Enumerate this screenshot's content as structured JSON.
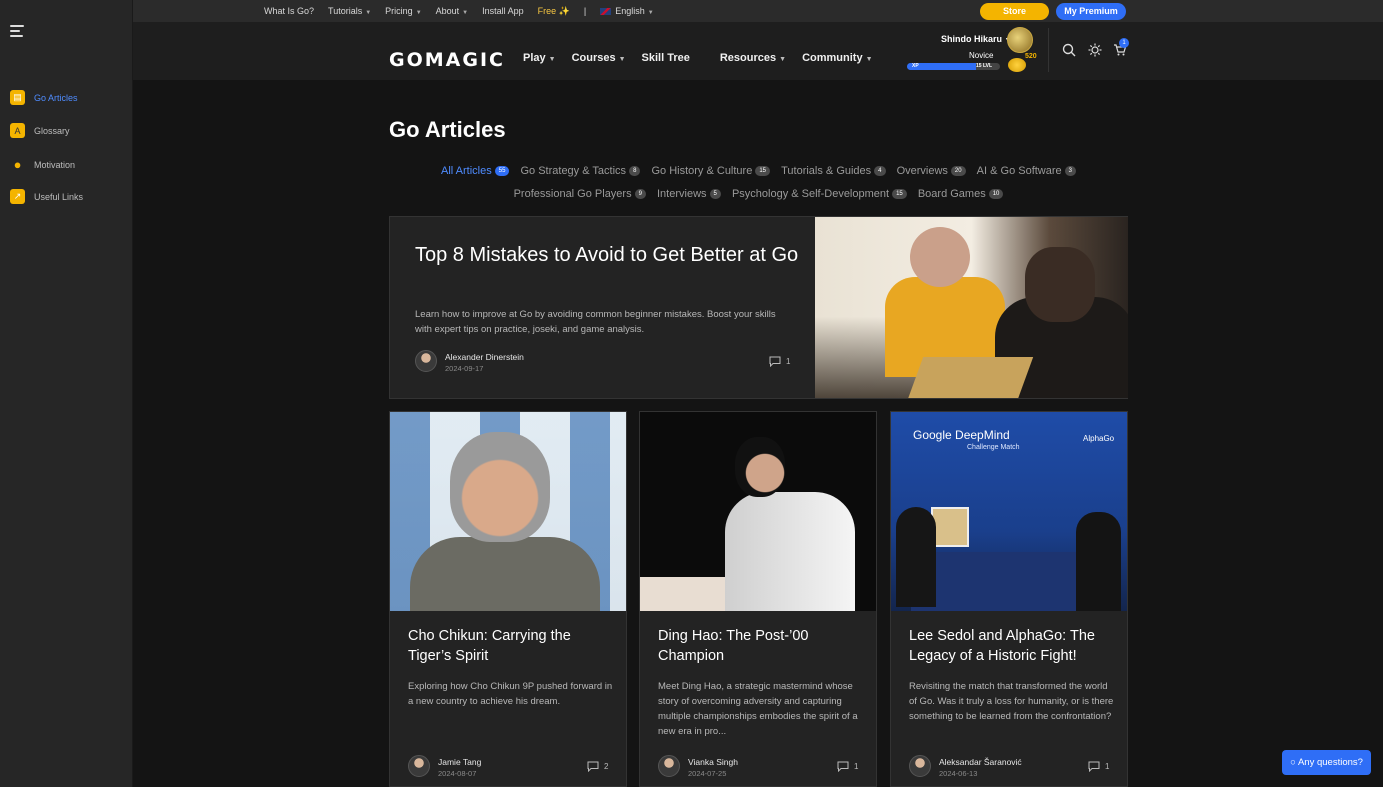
{
  "sidebar": {
    "items": [
      {
        "label": "Go Articles",
        "icon": "book-icon",
        "color": "#f4b400",
        "active": true
      },
      {
        "label": "Glossary",
        "icon": "glossary-icon",
        "color": "#f4b400"
      },
      {
        "label": "Motivation",
        "icon": "lightbulb-icon",
        "color": "#f4b400"
      },
      {
        "label": "Useful Links",
        "icon": "link-icon",
        "color": "#f4b400"
      }
    ]
  },
  "topbar": {
    "links": [
      "What Is Go?",
      "Tutorials",
      "Pricing",
      "About",
      "Install App"
    ],
    "free": "Free ✨",
    "language": "English",
    "store": "Store",
    "premium": "My Premium"
  },
  "header": {
    "logo": "GOMAGIC",
    "nav": [
      "Play",
      "Courses",
      "Skill Tree",
      "Resources",
      "Community"
    ],
    "user": {
      "name": "Shindo Hikaru",
      "rank": "Novice",
      "coins": "520",
      "xp_label": "XP",
      "level": "15 LVL",
      "xp_progress": 0.74
    },
    "cart_count": "1"
  },
  "page": {
    "title": "Go Articles",
    "categories": [
      {
        "label": "All Articles",
        "count": "55",
        "active": true
      },
      {
        "label": "Go Strategy & Tactics",
        "count": "8"
      },
      {
        "label": "Go History & Culture",
        "count": "15"
      },
      {
        "label": "Tutorials & Guides",
        "count": "4"
      },
      {
        "label": "Overviews",
        "count": "20"
      },
      {
        "label": "AI & Go Software",
        "count": "3"
      },
      {
        "label": "Professional Go Players",
        "count": "9"
      },
      {
        "label": "Interviews",
        "count": "5"
      },
      {
        "label": "Psychology & Self-Development",
        "count": "15"
      },
      {
        "label": "Board Games",
        "count": "10"
      }
    ]
  },
  "featured": {
    "title": "Top 8 Mistakes to Avoid to Get Better at Go",
    "description": "Learn how to improve at Go by avoiding common beginner mistakes. Boost your skills with expert tips on practice, joseki, and game analysis.",
    "author": "Alexander Dinerstein",
    "date": "2024-09-17",
    "comments": "1"
  },
  "cards": [
    {
      "title": "Cho Chikun: Carrying the Tiger’s Spirit",
      "description": "Exploring how Cho Chikun 9P pushed forward in a new country to achieve his dream.",
      "author": "Jamie Tang",
      "date": "2024-08-07",
      "comments": "2"
    },
    {
      "title": "Ding Hao: The Post-’00 Champion",
      "description": "Meet Ding Hao, a strategic mastermind whose story of overcoming adversity and capturing multiple championships embodies the spirit of a new era in pro...",
      "author": "Vianka Singh",
      "date": "2024-07-25",
      "comments": "1"
    },
    {
      "title": "Lee Sedol and AlphaGo: The Legacy of a Historic Fight!",
      "description": "Revisiting the match that transformed the world of Go. Was it truly a loss for humanity, or is there something to be learned from the confrontation?",
      "author": "Aleksandar Šaranović",
      "date": "2024-06-13",
      "comments": "1"
    }
  ],
  "card3_image_text": {
    "brand": "Google DeepMind",
    "event": "Challenge Match",
    "alphago": "AlphaGo"
  },
  "chat": "Any questions?"
}
